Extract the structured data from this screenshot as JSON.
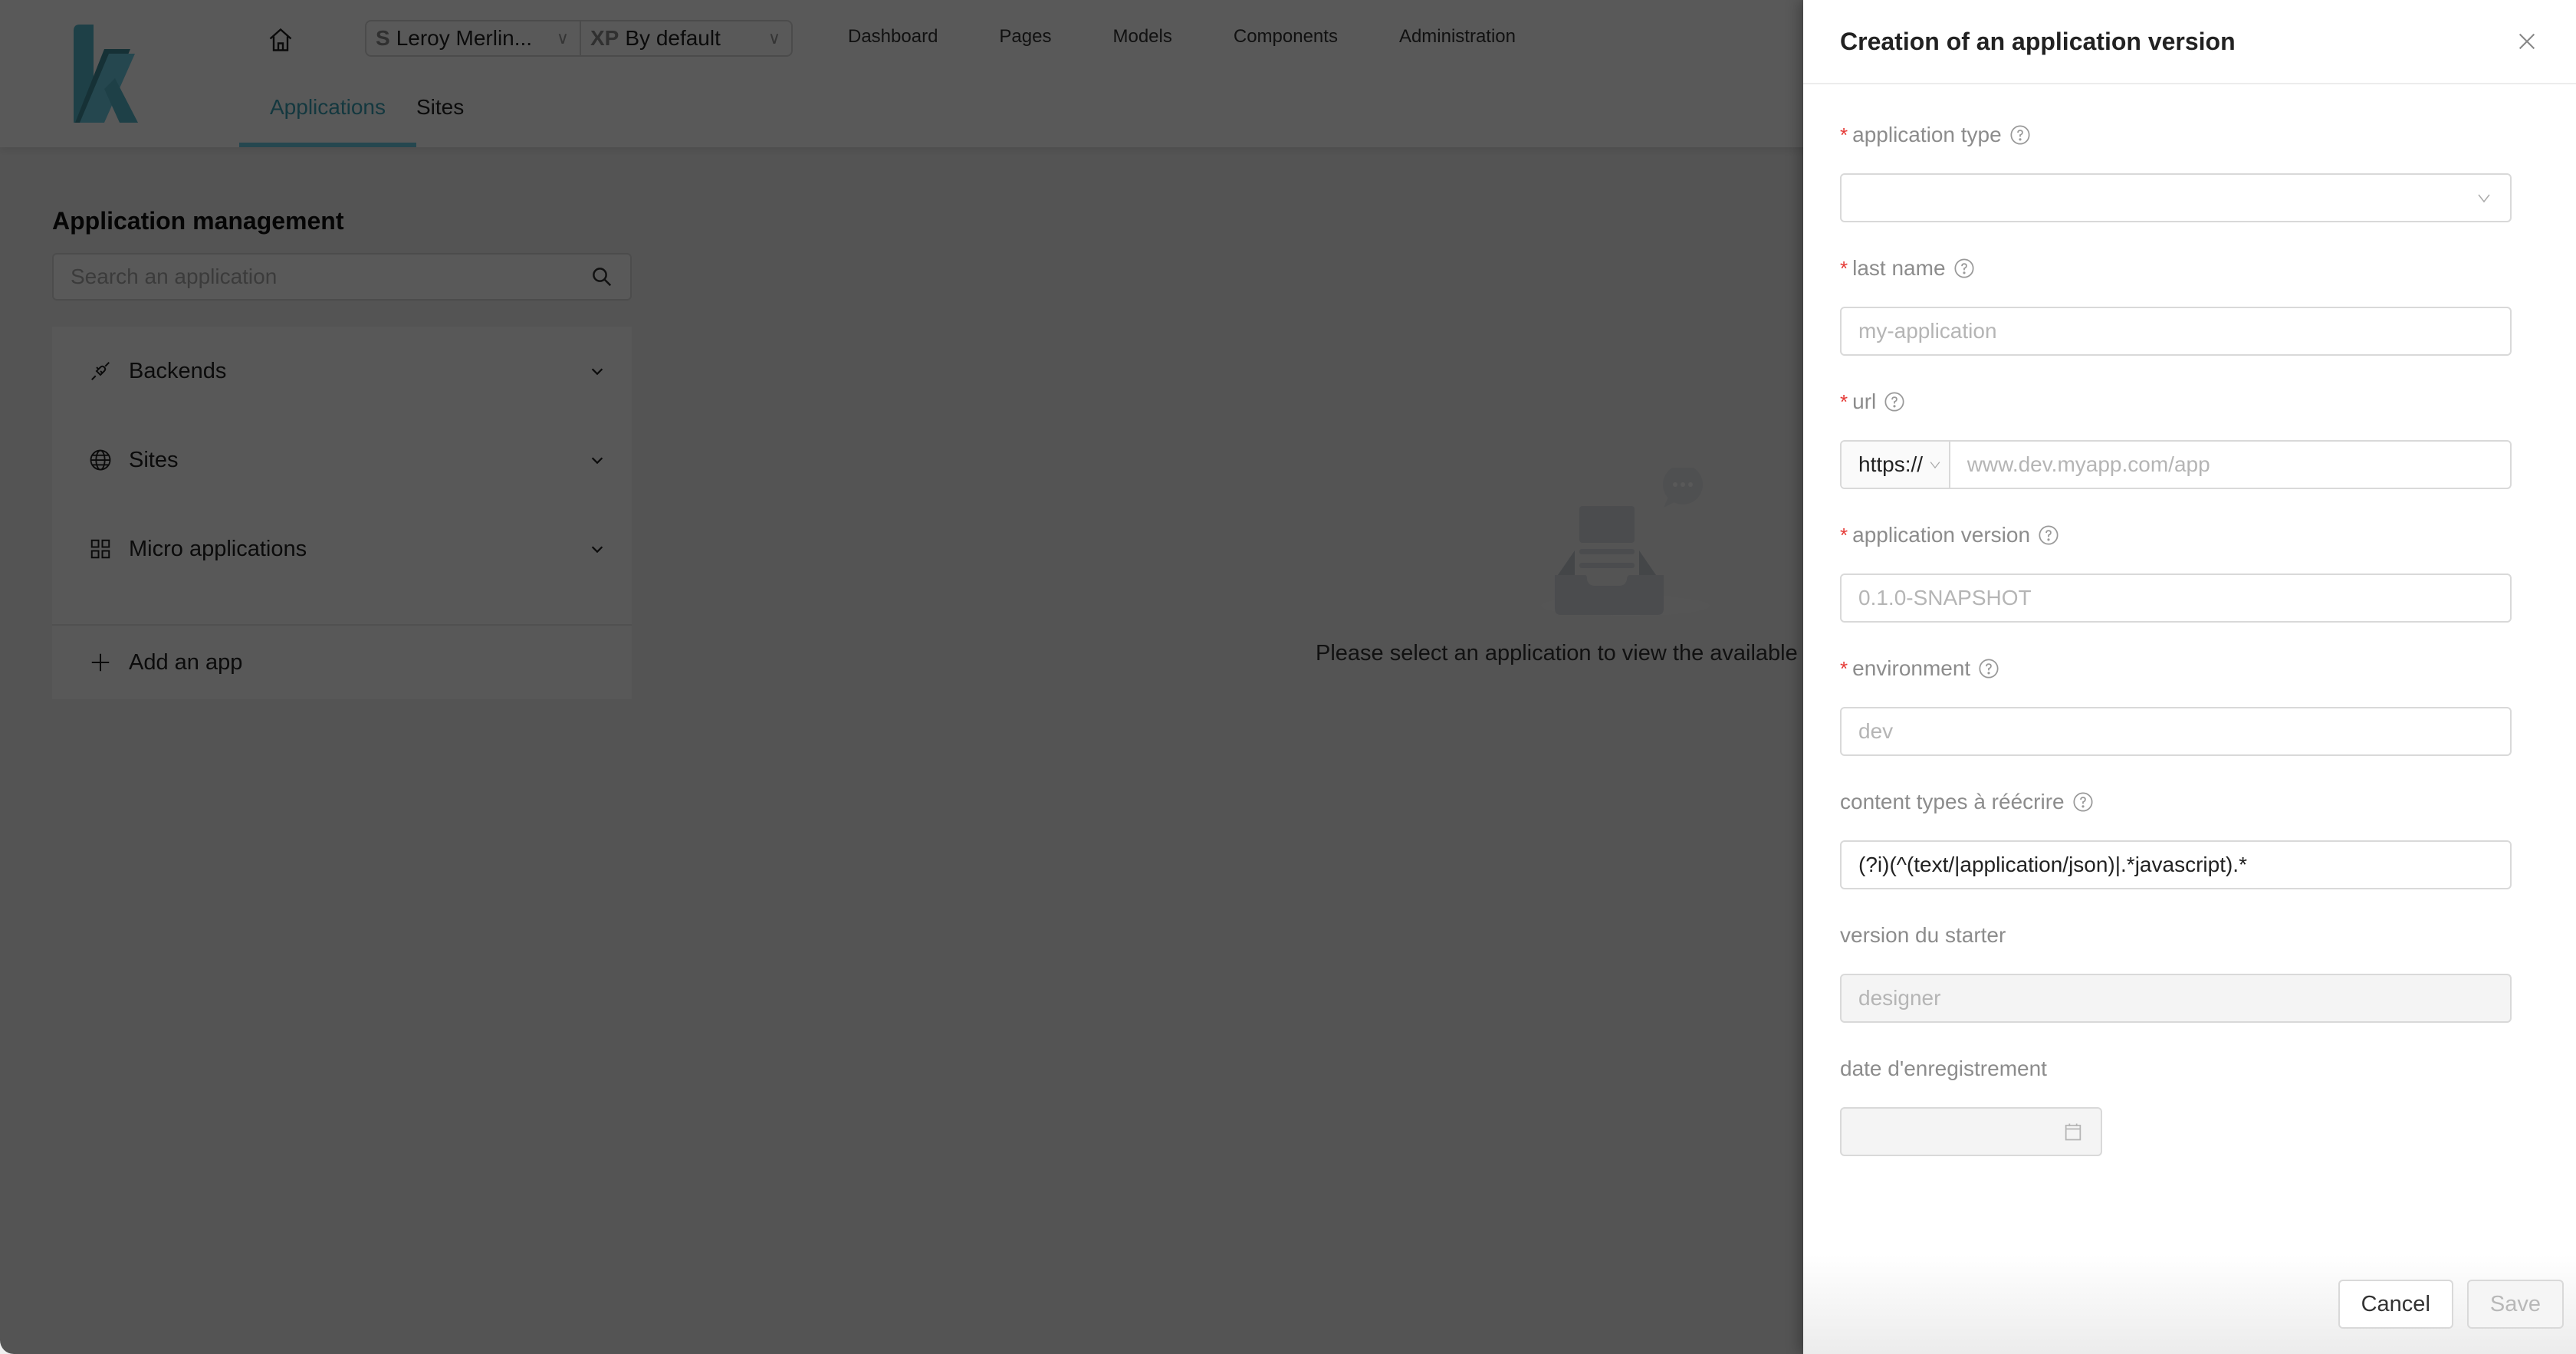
{
  "header": {
    "logo_letter": "k",
    "context": {
      "site_prefix": "S",
      "site_value": "Leroy Merlin...",
      "experience_prefix": "XP",
      "experience_value": "By default"
    },
    "nav": [
      "Dashboard",
      "Pages",
      "Models",
      "Components",
      "Administration"
    ],
    "subtabs": [
      {
        "label": "Applications",
        "active": true
      },
      {
        "label": "Sites",
        "active": false
      }
    ]
  },
  "sidebar": {
    "title": "Application management",
    "search_placeholder": "Search an application",
    "groups": [
      {
        "label": "Backends",
        "icon": "plug-icon"
      },
      {
        "label": "Sites",
        "icon": "globe-icon"
      },
      {
        "label": "Micro applications",
        "icon": "grid-icon"
      }
    ],
    "add_label": "Add an app"
  },
  "empty_state": {
    "message": "Please select an application to view the available"
  },
  "drawer": {
    "title": "Creation of an application version",
    "fields": {
      "app_type": {
        "label": "application type",
        "required": true,
        "value": ""
      },
      "last_name": {
        "label": "last name",
        "required": true,
        "placeholder": "my-application",
        "value": ""
      },
      "url": {
        "label": "url",
        "required": true,
        "protocol": "https://",
        "placeholder": "www.dev.myapp.com/app",
        "value": ""
      },
      "app_version": {
        "label": "application version",
        "required": true,
        "placeholder": "0.1.0-SNAPSHOT",
        "value": ""
      },
      "environment": {
        "label": "environment",
        "required": true,
        "placeholder": "dev",
        "value": ""
      },
      "content_types": {
        "label": "content types à réécrire",
        "required": false,
        "value": "(?i)(^(text/|application/json)|.*javascript).*"
      },
      "starter_version": {
        "label": "version du starter",
        "required": false,
        "placeholder": "designer",
        "disabled": true
      },
      "registration_date": {
        "label": "date d'enregistrement",
        "required": false,
        "value": "",
        "disabled": true
      }
    },
    "cancel_label": "Cancel",
    "save_label": "Save"
  },
  "colors": {
    "brand_teal": "#3aa0b4",
    "required_red": "#e53935"
  }
}
